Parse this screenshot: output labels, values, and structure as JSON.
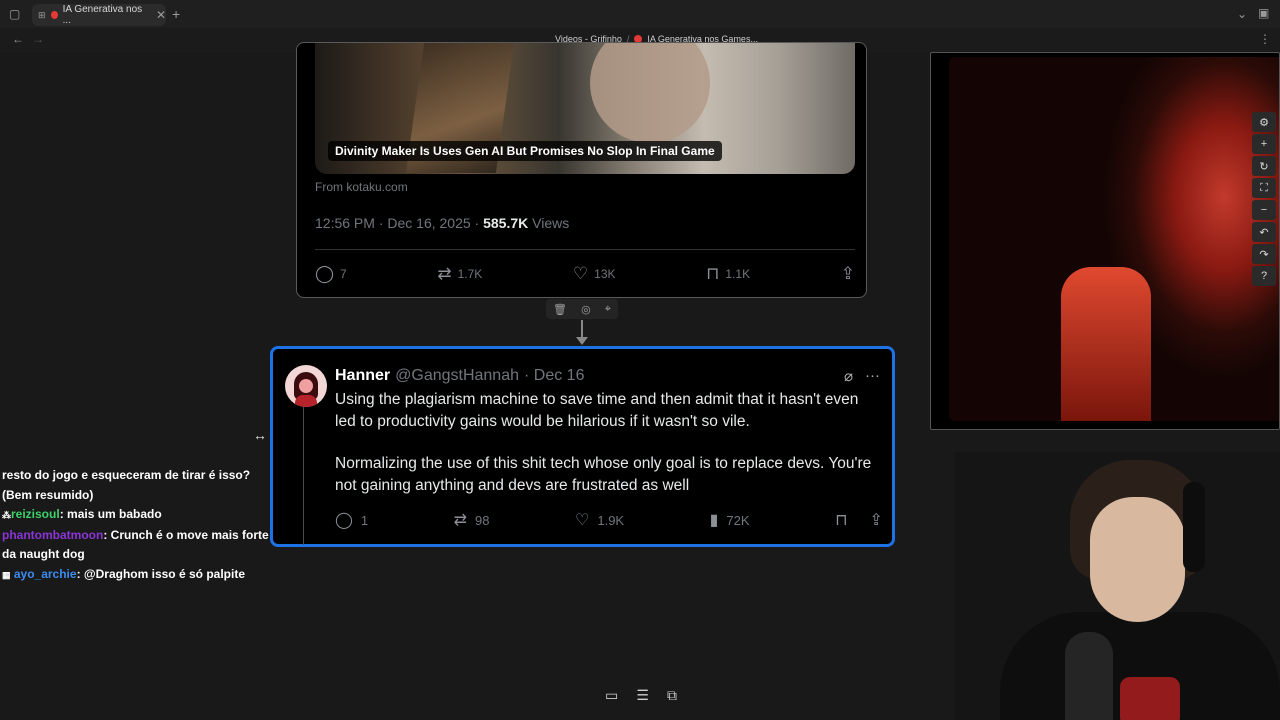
{
  "browser": {
    "tab_title": "IA Generativa nos ...",
    "breadcrumb": [
      "Videos - Grifinho",
      "/",
      "IA Generativa nos Games..."
    ]
  },
  "post1": {
    "image_caption": "Divinity Maker Is Uses Gen AI But Promises No Slop In Final Game",
    "source": "From kotaku.com",
    "time": "12:56 PM · Dec 16, 2025 · ",
    "views_count": "585.7K",
    "views_label": " Views",
    "replies": "7",
    "reposts": "1.7K",
    "likes": "13K",
    "bookmarks": "1.1K"
  },
  "post2": {
    "name": "Hanner",
    "handle": "@GangstHannah",
    "date": "· Dec 16",
    "text_p1": "Using the plagiarism machine to save time and then admit that it hasn't even led to productivity gains would be hilarious if it wasn't so vile.",
    "text_p2": "Normalizing the use of this shit tech whose only goal is to replace devs. You're not gaining anything and devs are frustrated as well",
    "replies": "1",
    "reposts": "98",
    "likes": "1.9K",
    "views": "72K"
  },
  "chat": [
    {
      "user": "",
      "text": "resto do jogo e esqueceram de tirar é isso? (Bem resumido)"
    },
    {
      "user": "reizisoul",
      "text": "mais um babado",
      "color": "#3fd16a"
    },
    {
      "user": "phantombatmoon",
      "text": "Crunch é o move mais forte da naught dog",
      "color": "#8a35d6"
    },
    {
      "user": "ayo_archie",
      "text": "@Draghom isso é só palpite",
      "color": "#3a8cf0"
    }
  ],
  "colors": {
    "accent_border": "#1d72e6",
    "tweet_bg": "#000000",
    "canvas_bg": "#191919"
  }
}
